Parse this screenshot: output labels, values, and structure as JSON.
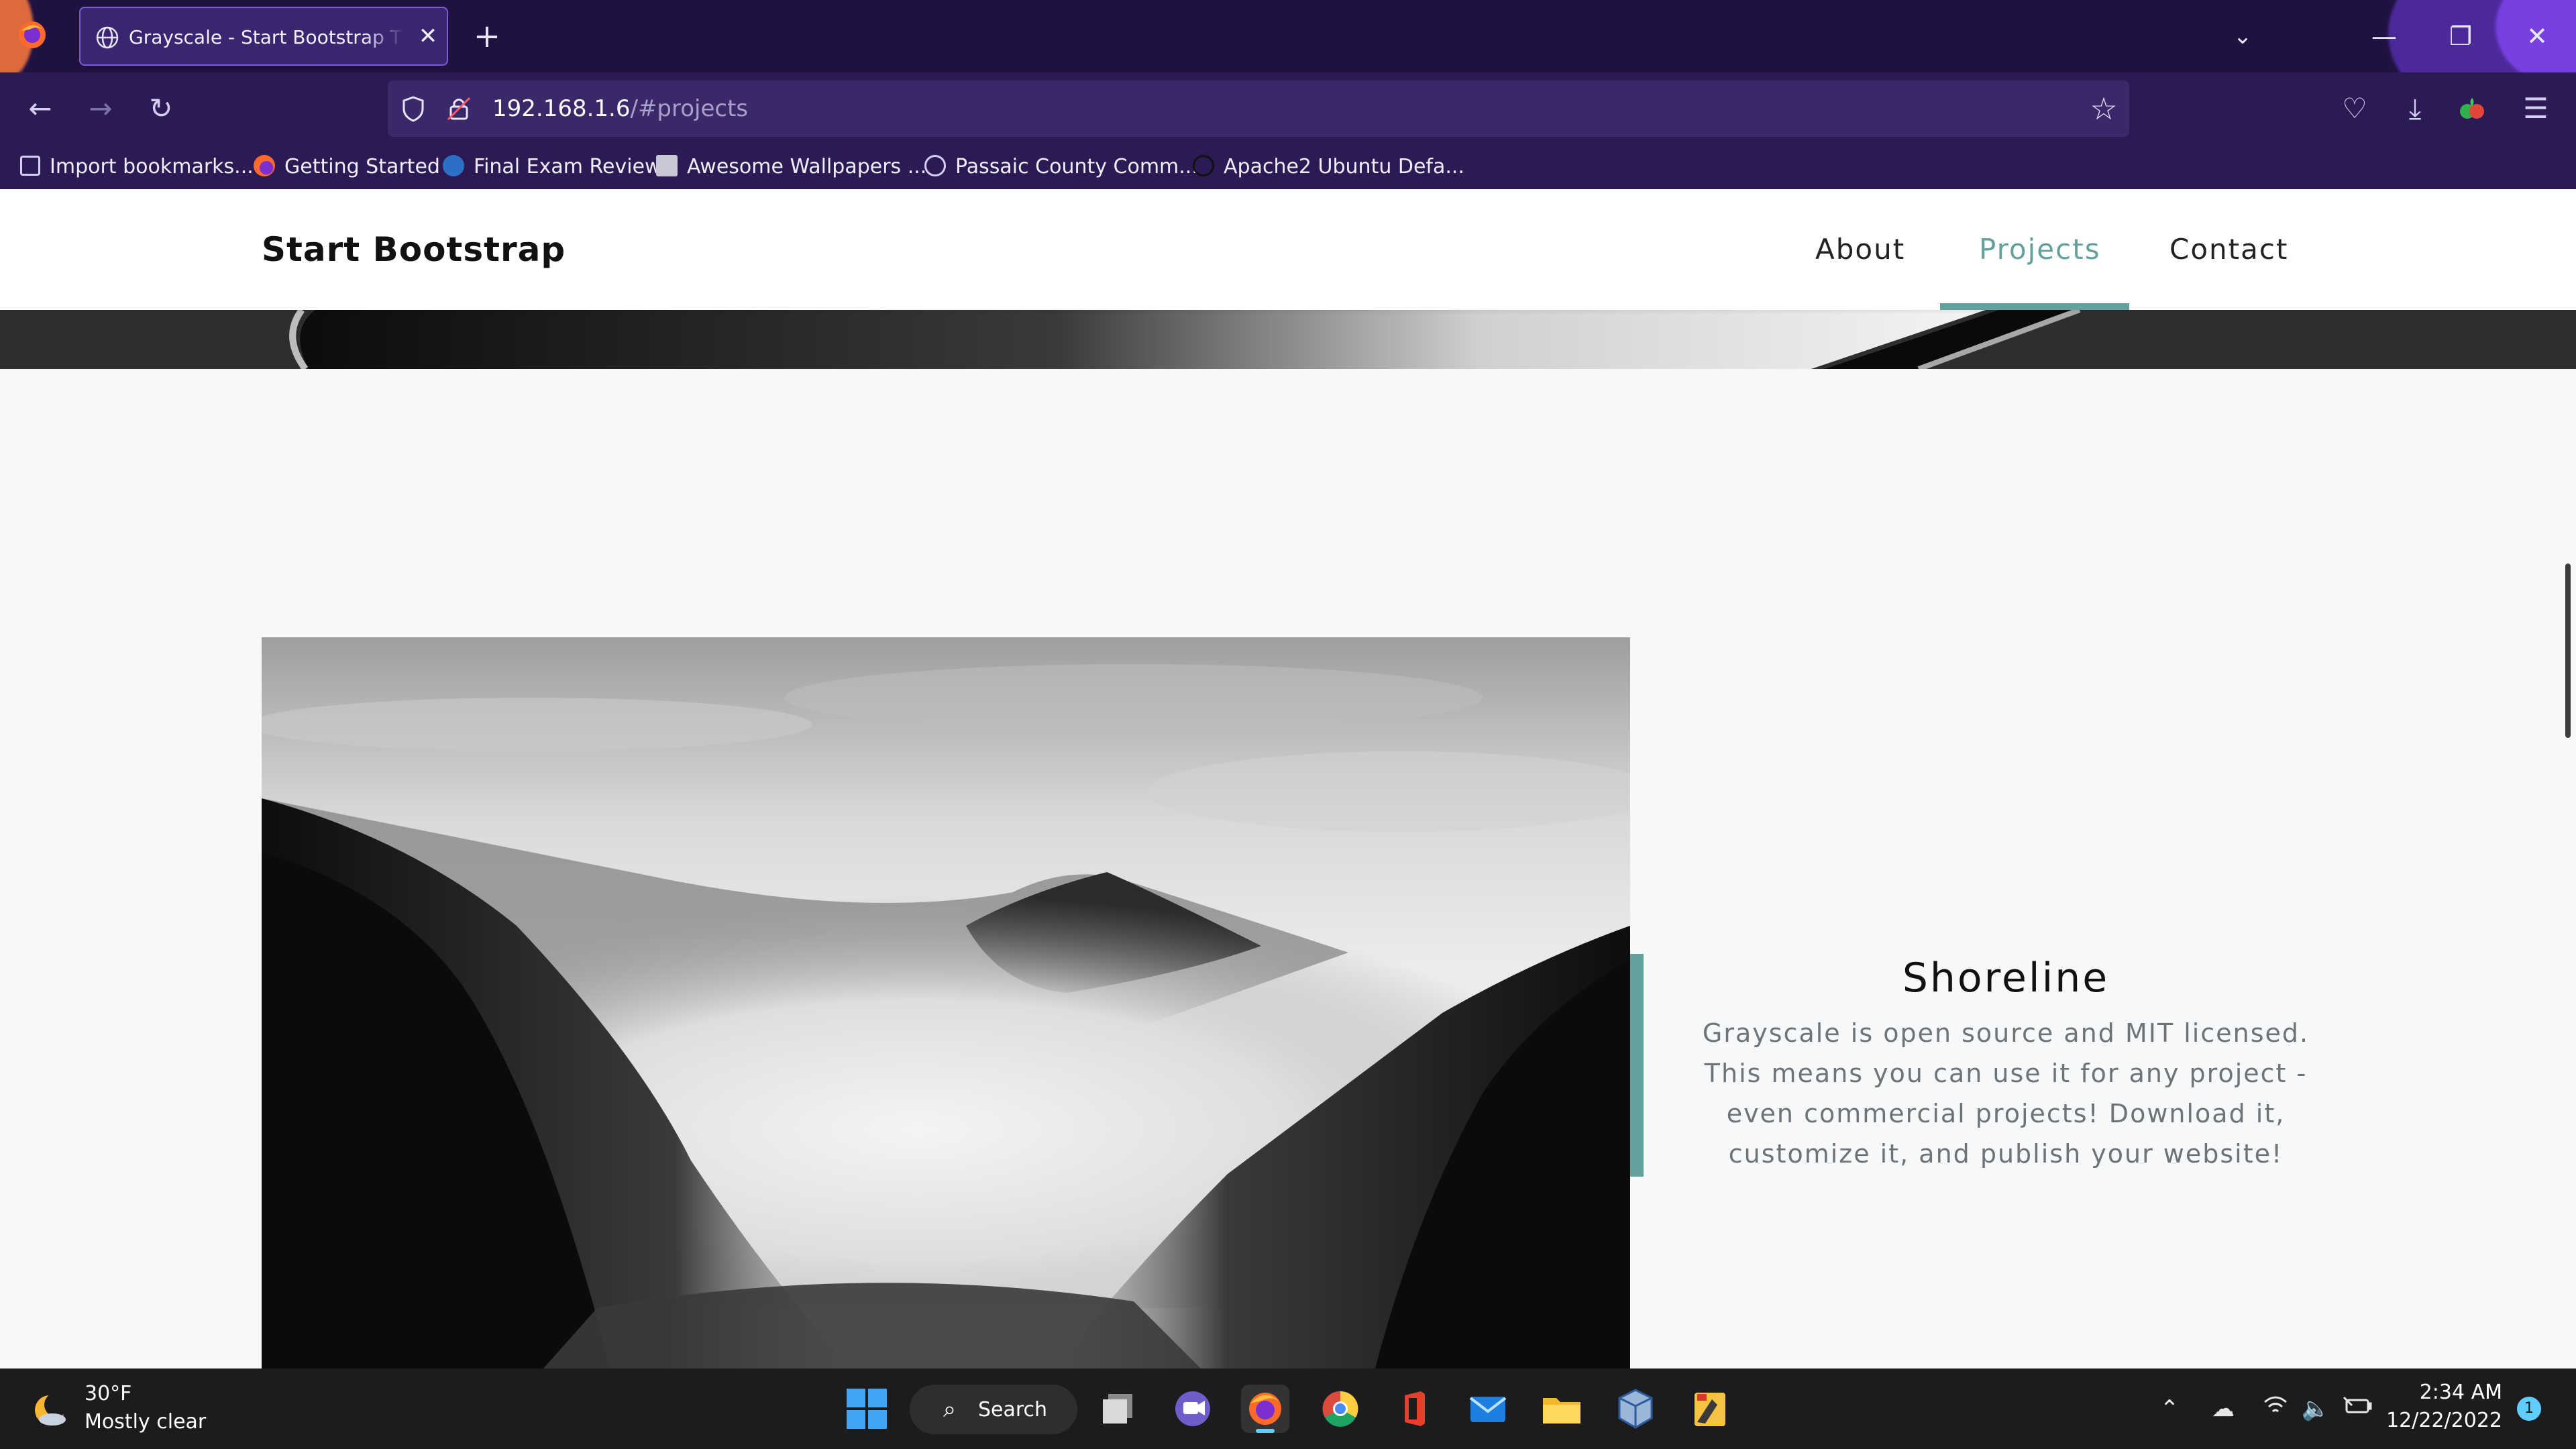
{
  "browser": {
    "tab_title": "Grayscale - Start Bootstrap Theme",
    "url_host": "192.168.1.6",
    "url_path": "/#projects",
    "bookmarks": [
      "Import bookmarks...",
      "Getting Started",
      "Final Exam Review",
      "Awesome Wallpapers ...",
      "Passaic County Comm...",
      "Apache2 Ubuntu Defa..."
    ]
  },
  "site": {
    "brand": "Start Bootstrap",
    "nav": [
      "About",
      "Projects",
      "Contact"
    ],
    "active_nav": "Projects",
    "project": {
      "title": "Shoreline",
      "description": "Grayscale is open source and MIT licensed. This means you can use it for any project - even commercial projects! Download it, customize it, and publish your website!"
    }
  },
  "taskbar": {
    "weather_temp": "30°F",
    "weather_desc": "Mostly clear",
    "search_label": "Search",
    "time": "2:34 AM",
    "date": "12/22/2022",
    "notification_count": "1"
  },
  "colors": {
    "accent": "#64a19d",
    "browser_bg": "#2b1a54"
  }
}
